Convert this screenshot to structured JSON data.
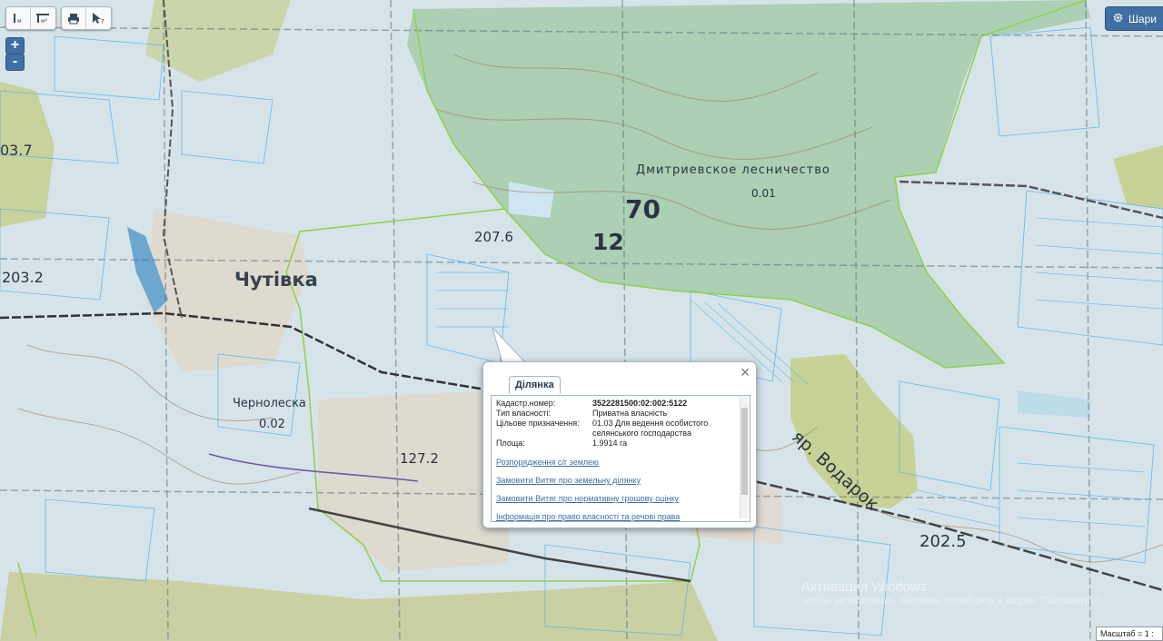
{
  "toolbar": {
    "measure_icons": [
      "ruler-icon",
      "ruler-area-icon"
    ],
    "print_icon": "print-icon",
    "identify_icon": "identify-cursor-icon"
  },
  "zoom": {
    "plus": "+",
    "minus": "-"
  },
  "layers": {
    "label": "Шари",
    "icon": "gear-icon"
  },
  "map_labels": {
    "village1": "Чутівка",
    "village2": "Чернолеска",
    "forestry": "Дмитриевское лесничество",
    "num70": "70",
    "num12": "12",
    "elev1": "207.6",
    "elev2": "127.2",
    "elev3": "202.5",
    "elev4": "203.2",
    "elev5": "03.7",
    "ravine": "яр. Водарок",
    "plot1": "0.01",
    "plot2": "0.02"
  },
  "popup": {
    "tab": "Ділянка",
    "rows": [
      {
        "label": "Кадастр.номер:",
        "value": "3522281500:02:002:5122",
        "bold": true
      },
      {
        "label": "Тип власності:",
        "value": "Приватна власність"
      },
      {
        "label": "Цільове призначення:",
        "value": "01.03 Для ведення особистого селянського господарства"
      },
      {
        "label": "Площа:",
        "value": "1.9914 га"
      }
    ],
    "links": [
      "Розпорядження с/г землею",
      "Замовити Витяг про земельну ділянку",
      "Замовити Витяг про нормативну грошову оцінку",
      "Інформація про право власності та речові права"
    ]
  },
  "scale": {
    "label": "Масштаб = 1 :"
  },
  "watermark": {
    "line1": "Активация Windows",
    "line2": "Чтобы активировать Windows, перейдите в раздел \"Параметры\"."
  }
}
